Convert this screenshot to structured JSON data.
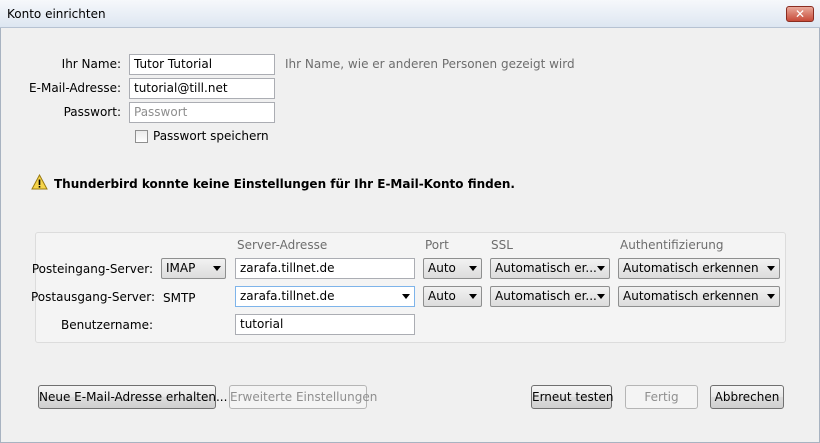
{
  "window": {
    "title": "Konto einrichten",
    "close_glyph": "✕"
  },
  "identity": {
    "name_label": "Ihr Name:",
    "name_value": "Tutor Tutorial",
    "name_hint": "Ihr Name, wie er anderen Personen gezeigt wird",
    "email_label": "E-Mail-Adresse:",
    "email_value": "tutorial@till.net",
    "password_label": "Passwort:",
    "password_placeholder": "Passwort",
    "remember_label": "Passwort speichern",
    "remember_checked": false
  },
  "warning": {
    "icon": "warning-icon",
    "text": "Thunderbird konnte keine Einstellungen für Ihr E-Mail-Konto finden."
  },
  "servers": {
    "headers": {
      "server": "Server-Adresse",
      "port": "Port",
      "ssl": "SSL",
      "auth": "Authentifizierung"
    },
    "incoming": {
      "label": "Posteingang-Server:",
      "protocol": "IMAP",
      "address": "zarafa.tillnet.de",
      "port": "Auto",
      "ssl": "Automatisch er...",
      "auth": "Automatisch erkennen"
    },
    "outgoing": {
      "label": "Postausgang-Server:",
      "protocol": "SMTP",
      "address": "zarafa.tillnet.de",
      "port": "Auto",
      "ssl": "Automatisch er...",
      "auth": "Automatisch erkennen"
    },
    "username": {
      "label": "Benutzername:",
      "value": "tutorial"
    }
  },
  "buttons": {
    "new_email": "Neue E-Mail-Adresse erhalten...",
    "advanced": "Erweiterte Einstellungen",
    "retest": "Erneut testen",
    "done": "Fertig",
    "cancel": "Abbrechen"
  }
}
